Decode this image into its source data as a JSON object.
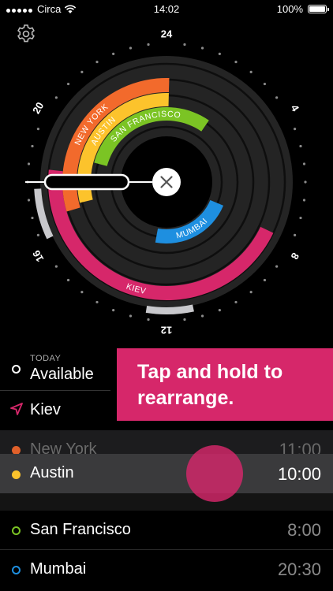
{
  "status_bar": {
    "carrier": "Circa",
    "time": "14:02",
    "battery": "100%",
    "battery_level": 1.0
  },
  "dial": {
    "hour_labels": [
      {
        "hour": 24,
        "label": "24"
      },
      {
        "hour": 4,
        "label": "4"
      },
      {
        "hour": 8,
        "label": "8"
      },
      {
        "hour": 12,
        "label": "12"
      },
      {
        "hour": 16,
        "label": "16"
      },
      {
        "hour": 20,
        "label": "20"
      }
    ],
    "rings": [
      {
        "name": "KIEV",
        "color": "#d6276a",
        "start_hour": 7.7,
        "end_hour": 18.4
      },
      {
        "name": "NEW YORK",
        "color": "#f26a2c",
        "start_hour": 16.9,
        "end_hour": 0.1
      },
      {
        "name": "AUSTIN",
        "color": "#fcc32c",
        "start_hour": 17.1,
        "end_hour": 0.1
      },
      {
        "name": "SAN FRANCISCO",
        "color": "#7bc424",
        "start_hour": 19.0,
        "end_hour": 2.3
      },
      {
        "name": "MUMBAI",
        "color": "#1e8fe0",
        "start_hour": 7.5,
        "end_hour": 12.7
      }
    ],
    "gray_highlight_hours": [
      [
        11.2,
        12.6
      ],
      [
        16.3,
        17.8
      ]
    ],
    "close_icon": "close-icon"
  },
  "list": {
    "today_label": "TODAY",
    "available_label": "Available",
    "kiev_label": "Kiev",
    "tooltip": "Tap and hold to rearrange.",
    "new_york": {
      "city": "New York",
      "time": "11:00"
    },
    "austin": {
      "city": "Austin",
      "time": "10:00"
    },
    "san_francisco": {
      "city": "San Francisco",
      "time": "8:00"
    },
    "mumbai": {
      "city": "Mumbai",
      "time": "20:30"
    }
  }
}
